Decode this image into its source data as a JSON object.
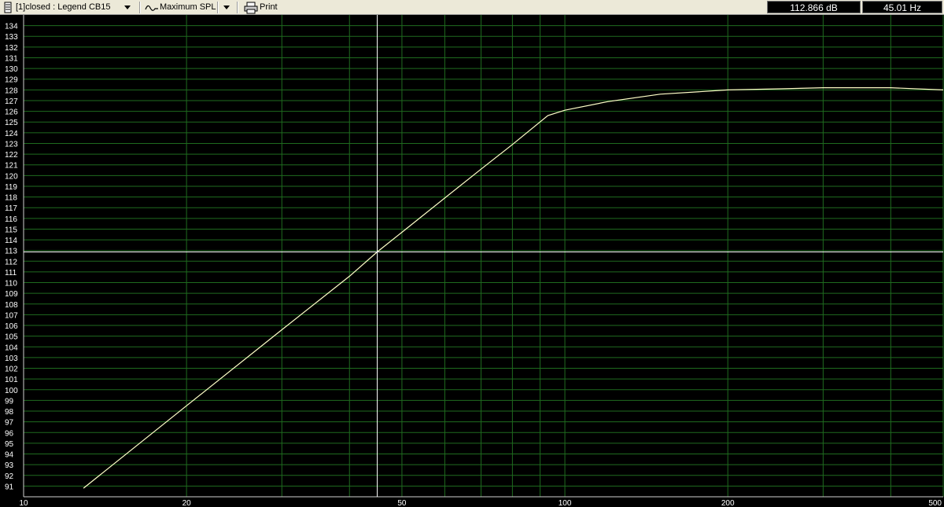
{
  "toolbar": {
    "box_select": "[1]closed : Legend CB15",
    "curve_select": "Maximum SPL",
    "print_label": "Print",
    "readout_db": "112.866 dB",
    "readout_hz": "45.01 Hz"
  },
  "icons": [
    "box-icon",
    "curve-icon",
    "printer-icon",
    "chevron-down-icon"
  ],
  "colors": {
    "background": "#000000",
    "grid": "#1f6b1f",
    "curve": "#ffffc8",
    "cursor": "#ffffff"
  },
  "chart_data": {
    "type": "line",
    "x_scale": "log",
    "xlim": [
      10,
      500
    ],
    "ylim": [
      90,
      135
    ],
    "x_ticks": [
      10,
      20,
      50,
      100,
      200,
      500
    ],
    "x_gridlines": [
      10,
      20,
      30,
      40,
      50,
      60,
      70,
      80,
      90,
      100,
      200,
      300,
      400,
      500
    ],
    "y_ticks": [
      91,
      92,
      93,
      94,
      95,
      96,
      97,
      98,
      99,
      100,
      101,
      102,
      103,
      104,
      105,
      106,
      107,
      108,
      109,
      110,
      111,
      112,
      113,
      114,
      115,
      116,
      117,
      118,
      119,
      120,
      121,
      122,
      123,
      124,
      125,
      126,
      127,
      128,
      129,
      130,
      131,
      132,
      133,
      134
    ],
    "grid": true,
    "cursor": {
      "x": 45.01,
      "y": 112.866
    },
    "series": [
      {
        "x": [
          12.9,
          20,
          30,
          40,
          45.01,
          50,
          60,
          70,
          80,
          93,
          100,
          120,
          150,
          200,
          250,
          300,
          400,
          500
        ],
        "y": [
          90.8,
          98.5,
          105.6,
          110.6,
          112.866,
          114.7,
          117.9,
          120.6,
          122.9,
          125.6,
          126.1,
          126.9,
          127.6,
          128.0,
          128.1,
          128.2,
          128.2,
          128.0
        ]
      }
    ]
  }
}
